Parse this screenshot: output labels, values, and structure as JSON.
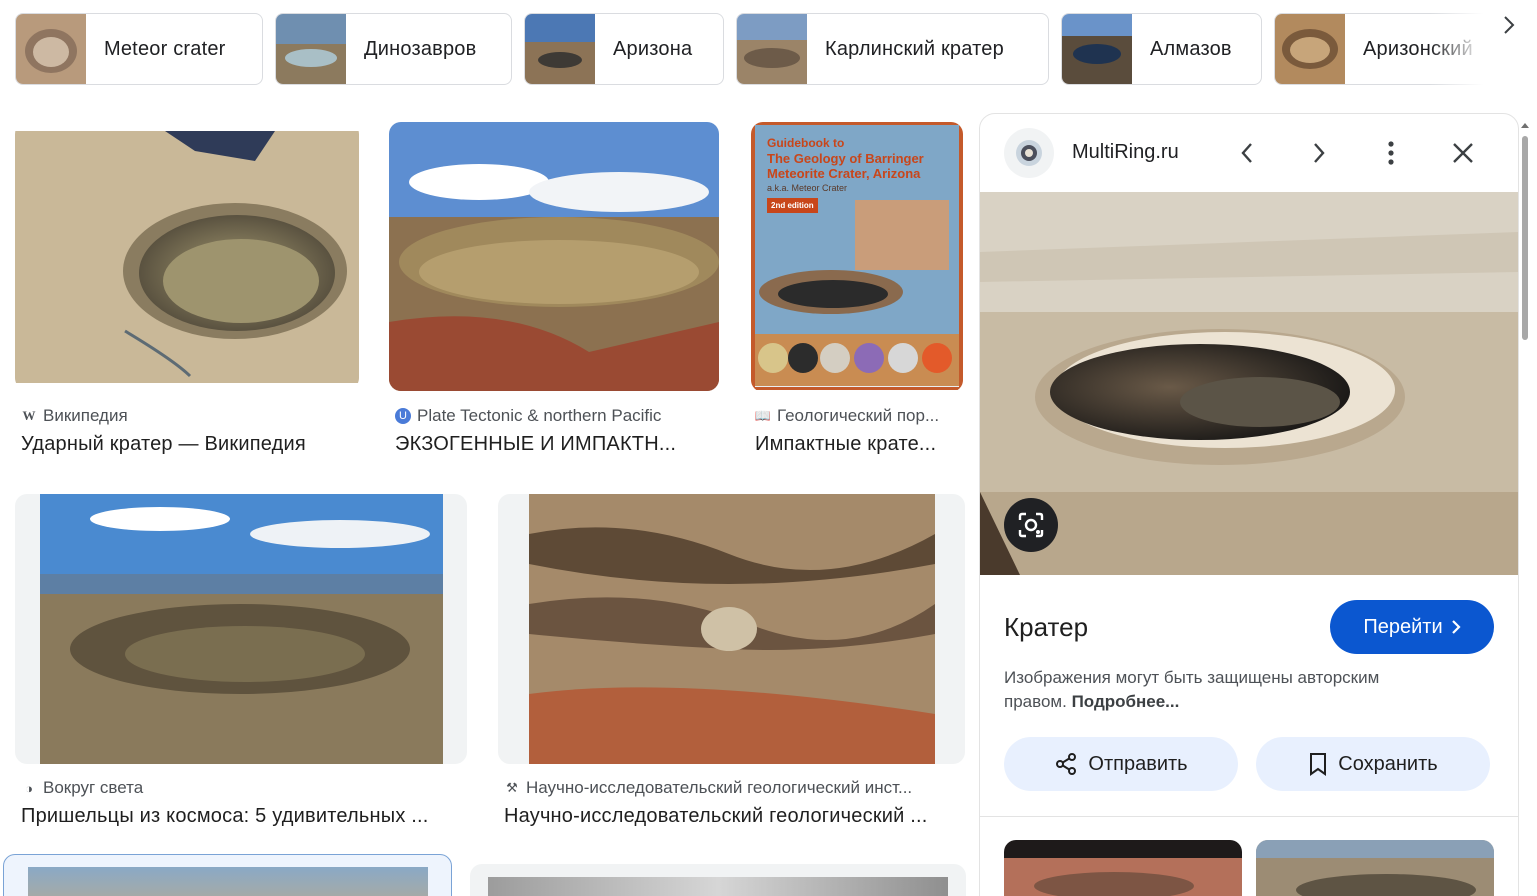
{
  "chips": [
    {
      "label": "Meteor crater"
    },
    {
      "label": "Динозавров"
    },
    {
      "label": "Аризона"
    },
    {
      "label": "Карлинский кратер"
    },
    {
      "label": "Алмазов"
    },
    {
      "label": "Аризонский"
    }
  ],
  "results": [
    {
      "source": "Википедия",
      "title": "Ударный кратер — Википедия",
      "favicon": "W"
    },
    {
      "source": "Plate Tectonic & northern Pacific",
      "title": "ЭКЗОГЕННЫЕ И ИМПАКТН...",
      "favicon": "U"
    },
    {
      "source": "Геологический пор...",
      "title": "Импактные крате...",
      "favicon": "book-icon"
    },
    {
      "source": "Вокруг света",
      "title": "Пришельцы из космоса: 5 удивительных ...",
      "favicon": "globe-icon"
    },
    {
      "source": "Научно-исследовательский геологический инст...",
      "title": "Научно-исследовательский геологический ...",
      "favicon": "hammers-icon"
    }
  ],
  "book_cover": {
    "line1": "Guidebook to",
    "line2": "The Geology of Barringer",
    "line3": "Meteorite Crater, Arizona",
    "line4": "a.k.a. Meteor Crater",
    "edition": "2nd edition"
  },
  "panel": {
    "site": "MultiRing.ru",
    "title": "Кратер",
    "visit_label": "Перейти",
    "copyright_text": "Изображения могут быть защищены авторским правом.",
    "more_link": "Подробнее...",
    "share_label": "Отправить",
    "save_label": "Сохранить"
  },
  "colors": {
    "accent": "#0b57d0",
    "action_bg": "#e8f0fe"
  }
}
